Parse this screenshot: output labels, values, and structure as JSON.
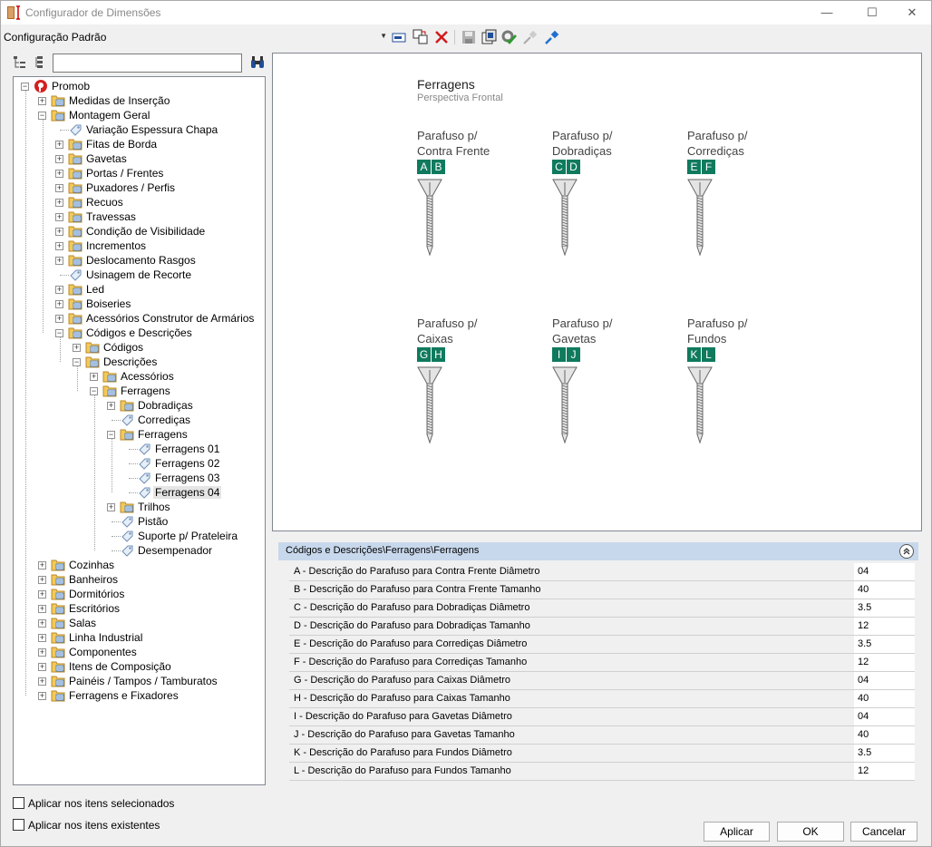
{
  "window": {
    "title": "Configurador de Dimensões",
    "minimize_glyph": "—",
    "maximize_glyph": "☐",
    "close_glyph": "✕"
  },
  "toolbar": {
    "config_value": "Configuração Padrão",
    "dropdown_glyph": "▼",
    "icons": [
      "rename-icon",
      "copy-icon",
      "delete-icon",
      "save-icon",
      "export-icon",
      "settings-check-icon",
      "connect-icon",
      "disconnect-icon"
    ]
  },
  "tree_toolbar": {
    "search_value": "",
    "find_glyph": "🔭"
  },
  "tree": {
    "root": "Promob",
    "items": [
      {
        "label": "Medidas de Inserção"
      },
      {
        "label": "Montagem Geral"
      },
      {
        "label": "Variação Espessura Chapa"
      },
      {
        "label": "Fitas de Borda"
      },
      {
        "label": "Gavetas"
      },
      {
        "label": "Portas / Frentes"
      },
      {
        "label": "Puxadores / Perfis"
      },
      {
        "label": "Recuos"
      },
      {
        "label": "Travessas"
      },
      {
        "label": "Condição de Visibilidade"
      },
      {
        "label": "Incrementos"
      },
      {
        "label": "Deslocamento Rasgos"
      },
      {
        "label": "Usinagem de Recorte"
      },
      {
        "label": "Led"
      },
      {
        "label": "Boiseries"
      },
      {
        "label": "Acessórios Construtor de Armários"
      },
      {
        "label": "Códigos e Descrições"
      },
      {
        "label": "Códigos"
      },
      {
        "label": "Descrições"
      },
      {
        "label": "Acessórios"
      },
      {
        "label": "Ferragens"
      },
      {
        "label": "Dobradiças"
      },
      {
        "label": "Corrediças"
      },
      {
        "label": "Ferragens"
      },
      {
        "label": "Ferragens 01"
      },
      {
        "label": "Ferragens 02"
      },
      {
        "label": "Ferragens 03"
      },
      {
        "label": "Ferragens 04"
      },
      {
        "label": "Trilhos"
      },
      {
        "label": "Pistão"
      },
      {
        "label": "Suporte p/ Prateleira"
      },
      {
        "label": "Desempenador"
      },
      {
        "label": "Cozinhas"
      },
      {
        "label": "Banheiros"
      },
      {
        "label": "Dormitórios"
      },
      {
        "label": "Escritórios"
      },
      {
        "label": "Salas"
      },
      {
        "label": "Linha Industrial"
      },
      {
        "label": "Componentes"
      },
      {
        "label": "Itens de Composição"
      },
      {
        "label": "Painéis / Tampos / Tamburatos"
      },
      {
        "label": "Ferragens e Fixadores"
      }
    ]
  },
  "checkboxes": {
    "apply_selected": "Aplicar nos itens selecionados",
    "apply_existing": "Aplicar nos itens existentes"
  },
  "preview": {
    "title": "Ferragens",
    "subtitle": "Perspectiva Frontal",
    "screws": [
      {
        "line1": "Parafuso p/",
        "line2": "Contra Frente",
        "l1": "A",
        "l2": "B"
      },
      {
        "line1": "Parafuso p/",
        "line2": "Dobradiças",
        "l1": "C",
        "l2": "D"
      },
      {
        "line1": "Parafuso p/",
        "line2": "Corrediças",
        "l1": "E",
        "l2": "F"
      },
      {
        "line1": "Parafuso p/",
        "line2": "Caixas",
        "l1": "G",
        "l2": "H"
      },
      {
        "line1": "Parafuso p/",
        "line2": "Gavetas",
        "l1": "I",
        "l2": "J"
      },
      {
        "line1": "Parafuso p/",
        "line2": "Fundos",
        "l1": "K",
        "l2": "L"
      }
    ]
  },
  "properties": {
    "header": "Códigos e Descrições\\Ferragens\\Ferragens",
    "collapse_glyph": "⌃",
    "rows": [
      {
        "name": "A - Descrição do Parafuso para Contra Frente Diâmetro",
        "value": "04"
      },
      {
        "name": "B - Descrição do Parafuso para Contra Frente Tamanho",
        "value": "40"
      },
      {
        "name": "C - Descrição do Parafuso para Dobradiças Diâmetro",
        "value": "3.5"
      },
      {
        "name": "D - Descrição do Parafuso para Dobradiças Tamanho",
        "value": "12"
      },
      {
        "name": "E - Descrição do Parafuso para Corrediças Diâmetro",
        "value": "3.5"
      },
      {
        "name": "F - Descrição do Parafuso para Corrediças Tamanho",
        "value": "12"
      },
      {
        "name": "G - Descrição do Parafuso para Caixas Diâmetro",
        "value": "04"
      },
      {
        "name": "H - Descrição do Parafuso para Caixas Tamanho",
        "value": "40"
      },
      {
        "name": "I - Descrição do Parafuso para Gavetas Diâmetro",
        "value": "04"
      },
      {
        "name": "J - Descrição do Parafuso para Gavetas Tamanho",
        "value": "40"
      },
      {
        "name": "K - Descrição do Parafuso para Fundos Diâmetro",
        "value": "3.5"
      },
      {
        "name": "L - Descrição do Parafuso para Fundos Tamanho",
        "value": "12"
      }
    ]
  },
  "buttons": {
    "apply": "Aplicar",
    "ok": "OK",
    "cancel": "Cancelar"
  },
  "colors": {
    "letter_badge": "#0f7a5e",
    "header_band": "#c8d8ec",
    "delete_red": "#d11a1a"
  }
}
